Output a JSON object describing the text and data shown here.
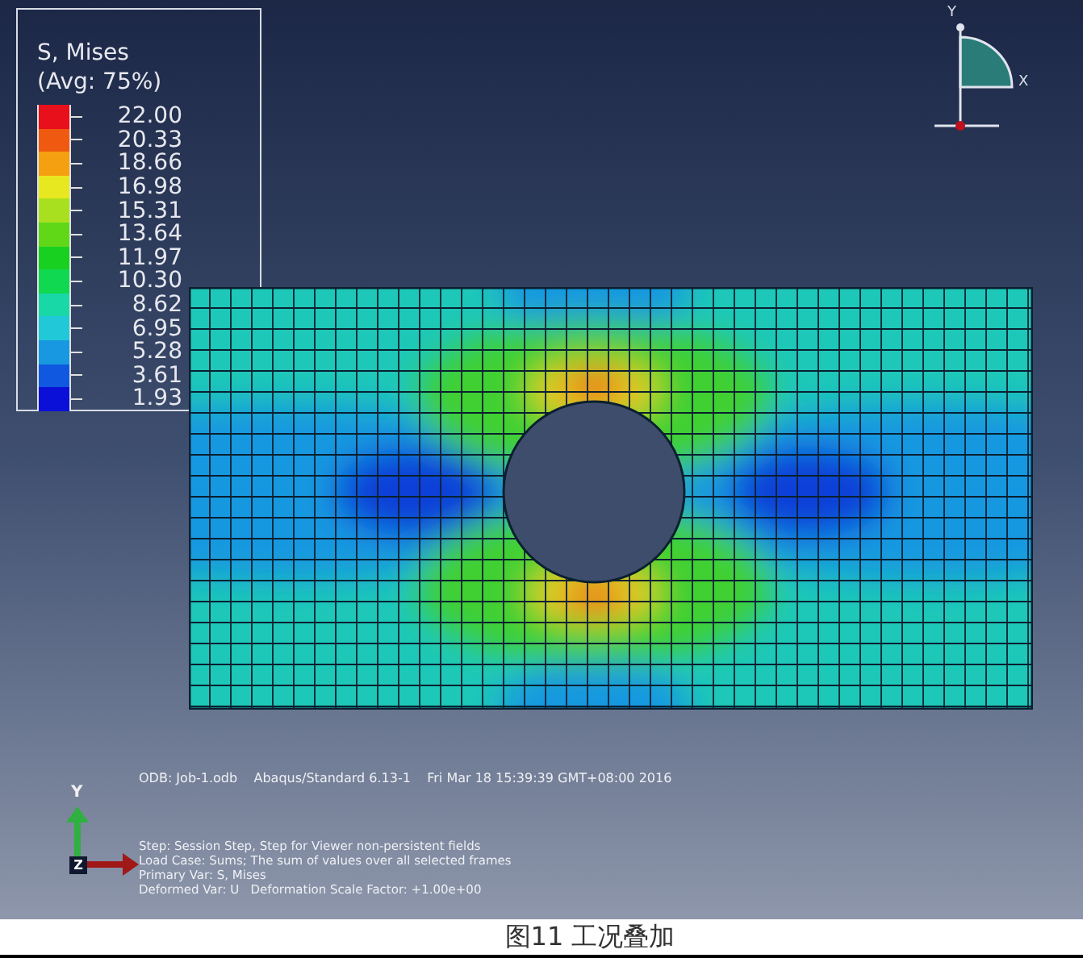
{
  "legend": {
    "title": "S, Mises",
    "subtitle": "(Avg: 75%)",
    "entries": [
      {
        "value": "22.00",
        "color": "#e8101a"
      },
      {
        "value": "20.33",
        "color": "#f05a10"
      },
      {
        "value": "18.66",
        "color": "#f5a010"
      },
      {
        "value": "16.98",
        "color": "#e8e820"
      },
      {
        "value": "15.31",
        "color": "#a8e020"
      },
      {
        "value": "13.64",
        "color": "#60d818"
      },
      {
        "value": "11.97",
        "color": "#18d020"
      },
      {
        "value": "10.30",
        "color": "#10d850"
      },
      {
        "value": "8.62",
        "color": "#18d8a8"
      },
      {
        "value": "6.95",
        "color": "#20c8d8"
      },
      {
        "value": "5.28",
        "color": "#1898e0"
      },
      {
        "value": "3.61",
        "color": "#1058e0"
      },
      {
        "value": "1.93",
        "color": "#0a10d8"
      }
    ]
  },
  "view_triad": {
    "y_label": "Y",
    "x_label": "X"
  },
  "axis_triad": {
    "y_label": "Y",
    "z_label": "Z"
  },
  "info": {
    "header": "ODB: Job-1.odb    Abaqus/Standard 6.13-1    Fri Mar 18 15:39:39 GMT+08:00 2016",
    "lines": [
      "Step: Session Step, Step for Viewer non-persistent fields",
      "Load Case: Sums; The sum of values over all selected frames",
      "Primary Var: S, Mises",
      "Deformed Var: U   Deformation Scale Factor: +1.00e+00"
    ]
  },
  "caption": "图11 工况叠加"
}
